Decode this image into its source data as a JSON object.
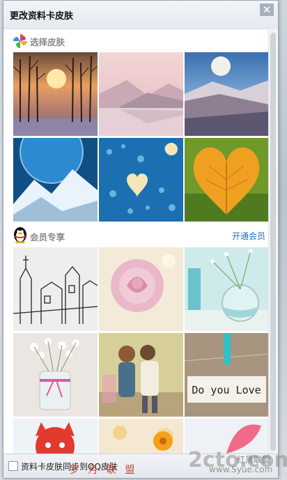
{
  "dialog": {
    "title": "更改资料卡皮肤",
    "close_icon": "close-icon"
  },
  "sections": {
    "skins": {
      "label": "选择皮肤",
      "icon": "pinwheel-icon",
      "items": [
        "sunset-trees",
        "pink-lake-mountains",
        "moon-over-mountain",
        "blue-planet-mountains",
        "raindrop-heart-glass",
        "orange-heart-leaf"
      ]
    },
    "vip": {
      "label": "会员专享",
      "icon": "penguin-icon",
      "link": "开通会员",
      "items": [
        "sketch-house",
        "pink-rose",
        "glass-bowl-flowers",
        "flowers-in-jar",
        "couple-kissing",
        "do-you-love",
        "red-toy",
        "orange-flower-bokeh",
        "pink-umbrella"
      ],
      "love_text": "Do you Love"
    }
  },
  "footer": {
    "checkbox_label": "资料卡皮肤同步到QQ皮肤",
    "checked": false
  },
  "watermark": {
    "text": "罗 月 联 盟",
    "url": "www.Syue.com",
    "logo": "2cto.com",
    "badge": "红黑联盟"
  },
  "colors": {
    "link": "#1f6fb8",
    "watermark": "#c0392b"
  }
}
